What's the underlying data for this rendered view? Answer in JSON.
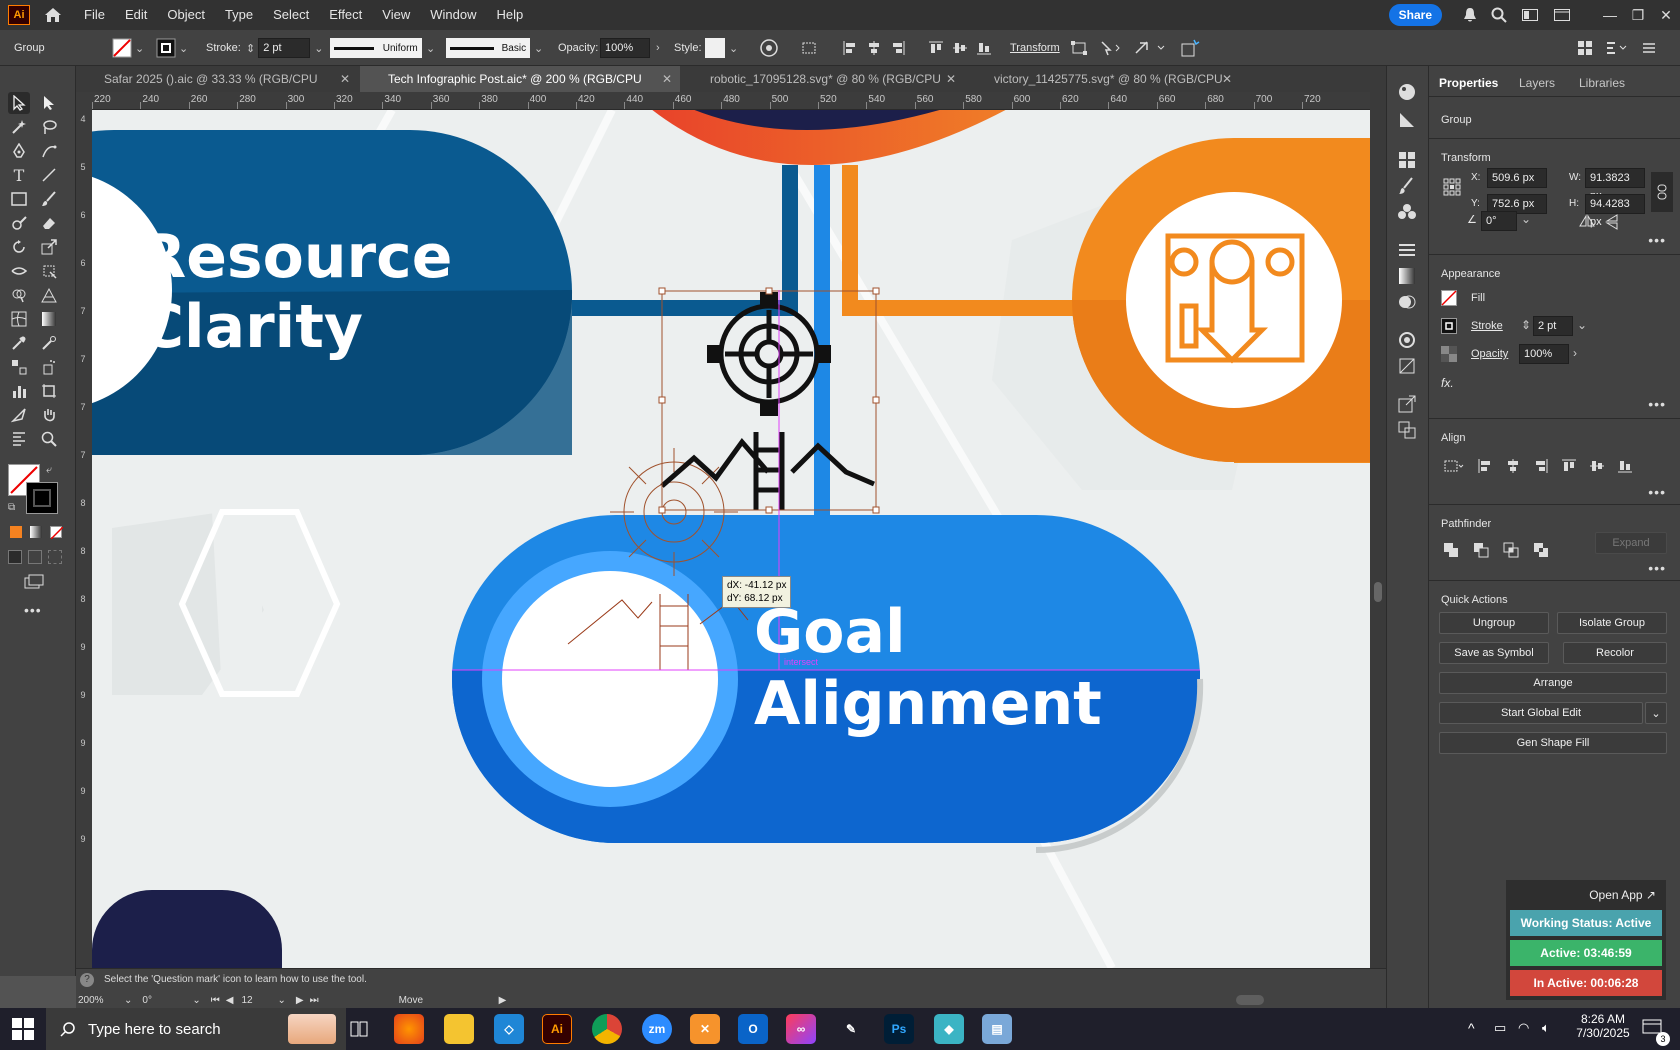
{
  "app": {
    "logo": "Ai",
    "home_icon": "home-icon"
  },
  "menu": [
    "File",
    "Edit",
    "Object",
    "Type",
    "Select",
    "Effect",
    "View",
    "Window",
    "Help"
  ],
  "topbar": {
    "share_label": "Share",
    "window_controls": [
      "minimize",
      "restore",
      "close"
    ]
  },
  "control_bar": {
    "selection": "Group",
    "stroke_label": "Stroke:",
    "stroke_value": "2 pt",
    "profile_uniform": "Uniform",
    "brush_basic": "Basic",
    "opacity_label": "Opacity:",
    "opacity_value": "100%",
    "style_label": "Style:",
    "transform_label": "Transform"
  },
  "tabs": [
    {
      "label": "Safar 2025 ().aic @ 33.33 % (RGB/CPU Preview)",
      "active": false
    },
    {
      "label": "Tech Infographic Post.aic* @ 200 % (RGB/CPU Preview)",
      "active": true
    },
    {
      "label": "robotic_17095128.svg* @ 80 % (RGB/CPU Preview)",
      "active": false
    },
    {
      "label": "victory_11425775.svg* @ 80 % (RGB/CPU Preview)",
      "active": false
    }
  ],
  "ruler_h": [
    "220",
    "240",
    "260",
    "280",
    "300",
    "320",
    "340",
    "360",
    "380",
    "400",
    "420",
    "440",
    "460",
    "480",
    "500",
    "520",
    "540",
    "560",
    "580",
    "600",
    "620",
    "640",
    "660",
    "680",
    "700",
    "720"
  ],
  "ruler_v": [
    "4",
    "5",
    "6",
    "6",
    "7",
    "7",
    "7",
    "7",
    "8",
    "8",
    "8",
    "9",
    "9",
    "9",
    "9",
    "9"
  ],
  "canvas": {
    "card1_line1": "Resource",
    "card1_line2": "Clarity",
    "card2_line1": "Goal",
    "card2_line2": "Alignment",
    "tooltip_dx": "dX: -41.12 px",
    "tooltip_dy": "dY: 68.12 px",
    "smart_guide": "intersect",
    "colors": {
      "blue_dark": "#0a5a90",
      "blue_light": "#1e88e5",
      "orange": "#f28a1e",
      "red": "#e53a2b"
    }
  },
  "props": {
    "tabs": [
      "Properties",
      "Layers",
      "Libraries"
    ],
    "group": "Group",
    "transform_title": "Transform",
    "x_label": "X:",
    "x_value": "509.6 px",
    "y_label": "Y:",
    "y_value": "752.6 px",
    "w_label": "W:",
    "w_value": "91.3823 px",
    "h_label": "H:",
    "h_value": "94.4283 px",
    "angle_value": "0°",
    "appearance_title": "Appearance",
    "fill_label": "Fill",
    "stroke_label": "Stroke",
    "stroke_value": "2 pt",
    "opacity_label": "Opacity",
    "opacity_value": "100%",
    "fx_label": "fx.",
    "align_title": "Align",
    "pathfinder_title": "Pathfinder",
    "expand_label": "Expand",
    "quick_actions_title": "Quick Actions",
    "ungroup": "Ungroup",
    "isolate_group": "Isolate Group",
    "save_symbol": "Save as Symbol",
    "recolor": "Recolor",
    "arrange": "Arrange",
    "start_global_edit": "Start Global Edit",
    "gen_shape_fill": "Gen Shape Fill"
  },
  "widget": {
    "open_app": "Open App ↗",
    "working_status": "Working Status: Active",
    "active_time": "Active: 03:46:59",
    "inactive_time": "In Active: 00:06:28",
    "colors": {
      "status": "#4aa3ad",
      "active": "#3bb46a",
      "inactive": "#d2473c"
    }
  },
  "status": {
    "hint": "Select the 'Question mark' icon to learn how to use the tool.",
    "zoom": "200%",
    "rotation": "0°",
    "artboard": "12",
    "mode": "Move"
  },
  "taskbar": {
    "search_placeholder": "Type here to search",
    "time": "8:26 AM",
    "date": "7/30/2025",
    "notification_count": "3"
  }
}
